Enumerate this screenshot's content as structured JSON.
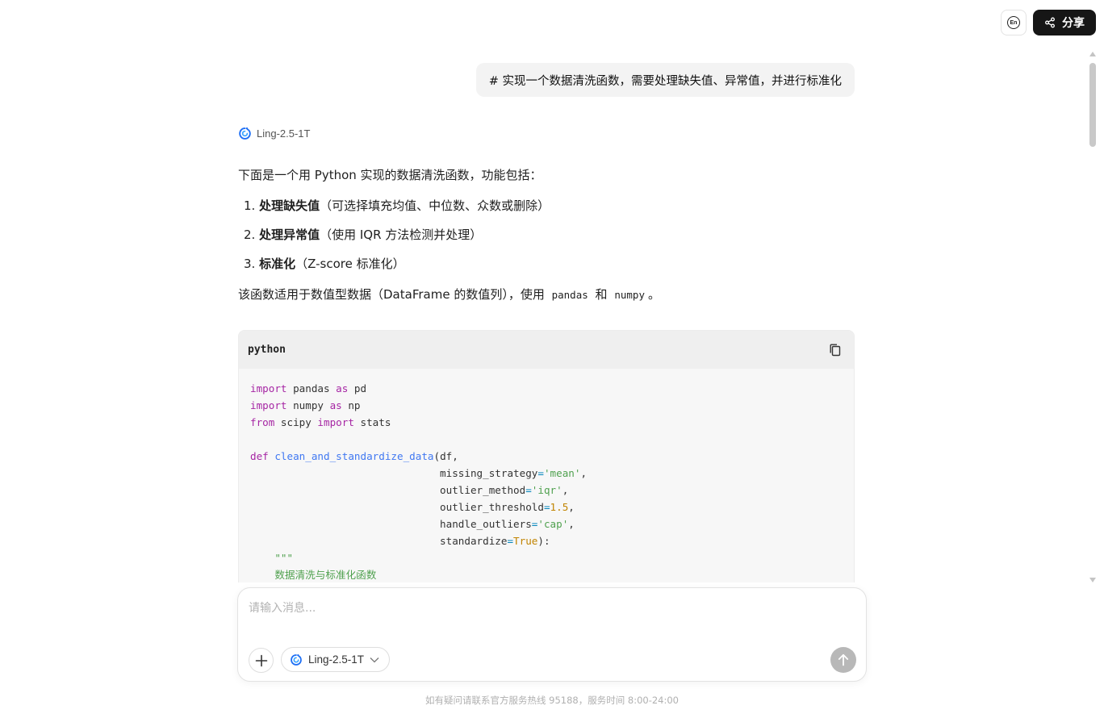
{
  "topbar": {
    "lang_label": "En",
    "share_label": "分享"
  },
  "conversation": {
    "user_message": "# 实现一个数据清洗函数，需要处理缺失值、异常值，并进行标准化",
    "model_name": "Ling-2.5-1T",
    "intro": "下面是一个用 Python 实现的数据清洗函数，功能包括：",
    "features": [
      {
        "num": "1.",
        "title": "处理缺失值",
        "desc": "（可选择填充均值、中位数、众数或删除）"
      },
      {
        "num": "2.",
        "title": "处理异常值",
        "desc": "（使用 IQR 方法检测并处理）"
      },
      {
        "num": "3.",
        "title": "标准化",
        "desc": "（Z-score 标准化）"
      }
    ],
    "note_prefix": "该函数适用于数值型数据（DataFrame 的数值列），使用",
    "note_code1": "pandas",
    "note_and": "和",
    "note_code2": "numpy",
    "note_suffix": "。",
    "code_language": "python",
    "code": {
      "import": "import",
      "from": "from",
      "as": "as",
      "def": "def",
      "l1_mod": " pandas ",
      "l1_alias": " pd",
      "l2_mod": " numpy ",
      "l2_alias": " np",
      "l3_mod": " scipy ",
      "l3_name": " stats",
      "func_name": "clean_and_standardize_data",
      "func_open": "(df,",
      "p1_name": "missing_strategy",
      "p1_val": "'mean'",
      "p2_name": "outlier_method",
      "p2_val": "'iqr'",
      "p3_name": "outlier_threshold",
      "p3_val": "1.5",
      "p4_name": "handle_outliers",
      "p4_val": "'cap'",
      "p5_name": "standardize",
      "p5_val": "True",
      "func_close": "):",
      "docstring_open": "\"\"\"",
      "docstring_line": "数据清洗与标准化函数"
    }
  },
  "composer": {
    "placeholder": "请输入消息...",
    "model_name": "Ling-2.5-1T"
  },
  "footer": {
    "text": "如有疑问请联系官方服务热线 95188，服务时间 8:00-24:00"
  },
  "colors": {
    "accent_blue": "#1e6ff5",
    "share_bg": "#161616",
    "send_disabled": "#b8b8b8"
  }
}
